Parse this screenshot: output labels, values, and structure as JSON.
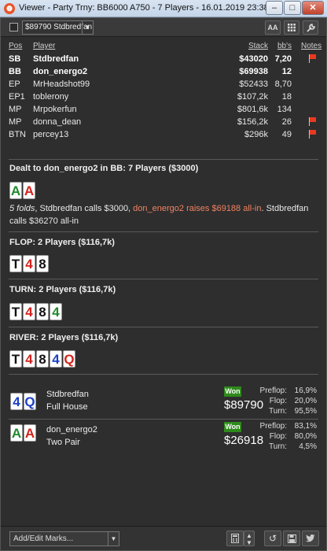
{
  "window": {
    "title": "Viewer - Party Trny: BB6000 A750 - 7 Players - 16.01.2019 23:38",
    "min": "–",
    "max": "□",
    "close": "✕"
  },
  "toolbar": {
    "hand_selector": "$89790 Stdbredfan",
    "font_size_label": "AA",
    "grid_icon": "grid-icon",
    "settings_icon": "wrench-icon"
  },
  "players_table": {
    "headers": {
      "pos": "Pos",
      "player": "Player",
      "stack": "Stack",
      "bbs": "bb's",
      "notes": "Notes"
    },
    "rows": [
      {
        "pos": "SB",
        "player": "Stdbredfan",
        "stack": "$43020",
        "bbs": "7,20",
        "bold": true,
        "flag": true
      },
      {
        "pos": "BB",
        "player": "don_energo2",
        "stack": "$69938",
        "bbs": "12",
        "bold": true,
        "flag": false
      },
      {
        "pos": "EP",
        "player": "MrHeadshot99",
        "stack": "$52433",
        "bbs": "8,70",
        "bold": false,
        "flag": false
      },
      {
        "pos": "EP1",
        "player": "toblerony",
        "stack": "$107,2k",
        "bbs": "18",
        "bold": false,
        "flag": false
      },
      {
        "pos": "MP",
        "player": "Mrpokerfun",
        "stack": "$801,6k",
        "bbs": "134",
        "bold": false,
        "flag": false
      },
      {
        "pos": "MP",
        "player": "donna_dean",
        "stack": "$156,2k",
        "bbs": "26",
        "bold": false,
        "flag": true
      },
      {
        "pos": "BTN",
        "player": "percey13",
        "stack": "$296k",
        "bbs": "49",
        "bold": false,
        "flag": true
      }
    ]
  },
  "preflop": {
    "title": "Dealt to don_energo2 in BB: 7 Players ($3000)",
    "cards": [
      {
        "rank": "A",
        "suit": "c"
      },
      {
        "rank": "A",
        "suit": "h"
      }
    ],
    "action_folds": "5 folds",
    "action_1": ", Stdbredfan calls $3000, ",
    "action_hero": "don_energo2 raises $69188 all-in",
    "action_2": ". Stdbredfan calls $36270 all-in"
  },
  "flop": {
    "title": "FLOP: 2 Players ($116,7k)",
    "cards": [
      {
        "rank": "T",
        "suit": "s"
      },
      {
        "rank": "4",
        "suit": "h"
      },
      {
        "rank": "8",
        "suit": "s"
      }
    ]
  },
  "turn": {
    "title": "TURN: 2 Players ($116,7k)",
    "cards": [
      {
        "rank": "T",
        "suit": "s"
      },
      {
        "rank": "4",
        "suit": "h"
      },
      {
        "rank": "8",
        "suit": "s"
      },
      {
        "rank": "4",
        "suit": "c"
      }
    ]
  },
  "river": {
    "title": "RIVER: 2 Players ($116,7k)",
    "cards": [
      {
        "rank": "T",
        "suit": "s"
      },
      {
        "rank": "4",
        "suit": "h"
      },
      {
        "rank": "8",
        "suit": "s"
      },
      {
        "rank": "4",
        "suit": "d"
      },
      {
        "rank": "Q",
        "suit": "h"
      }
    ]
  },
  "results": [
    {
      "cards": [
        {
          "rank": "4",
          "suit": "d"
        },
        {
          "rank": "Q",
          "suit": "d"
        }
      ],
      "name": "Stdbredfan",
      "hand": "Full House",
      "won_label": "Won",
      "amount": "$89790",
      "equity": [
        {
          "k": "Preflop:",
          "v": "16,9%"
        },
        {
          "k": "Flop:",
          "v": "20,0%"
        },
        {
          "k": "Turn:",
          "v": "95,5%"
        }
      ]
    },
    {
      "cards": [
        {
          "rank": "A",
          "suit": "c"
        },
        {
          "rank": "A",
          "suit": "h"
        }
      ],
      "name": "don_energo2",
      "hand": "Two Pair",
      "won_label": "Won",
      "amount": "$26918",
      "equity": [
        {
          "k": "Preflop:",
          "v": "83,1%"
        },
        {
          "k": "Flop:",
          "v": "80,0%"
        },
        {
          "k": "Turn:",
          "v": "4,5%"
        }
      ]
    }
  ],
  "bottom": {
    "marks_placeholder": "Add/Edit Marks...",
    "calculator_icon": "calculator-icon",
    "replay_icon": "replay-icon",
    "save_icon": "save-icon",
    "twitter_icon": "twitter-icon"
  },
  "colors": {
    "hero_action": "#f08262",
    "won_badge": "#2e8a1c",
    "flag": "#e83a1f"
  }
}
